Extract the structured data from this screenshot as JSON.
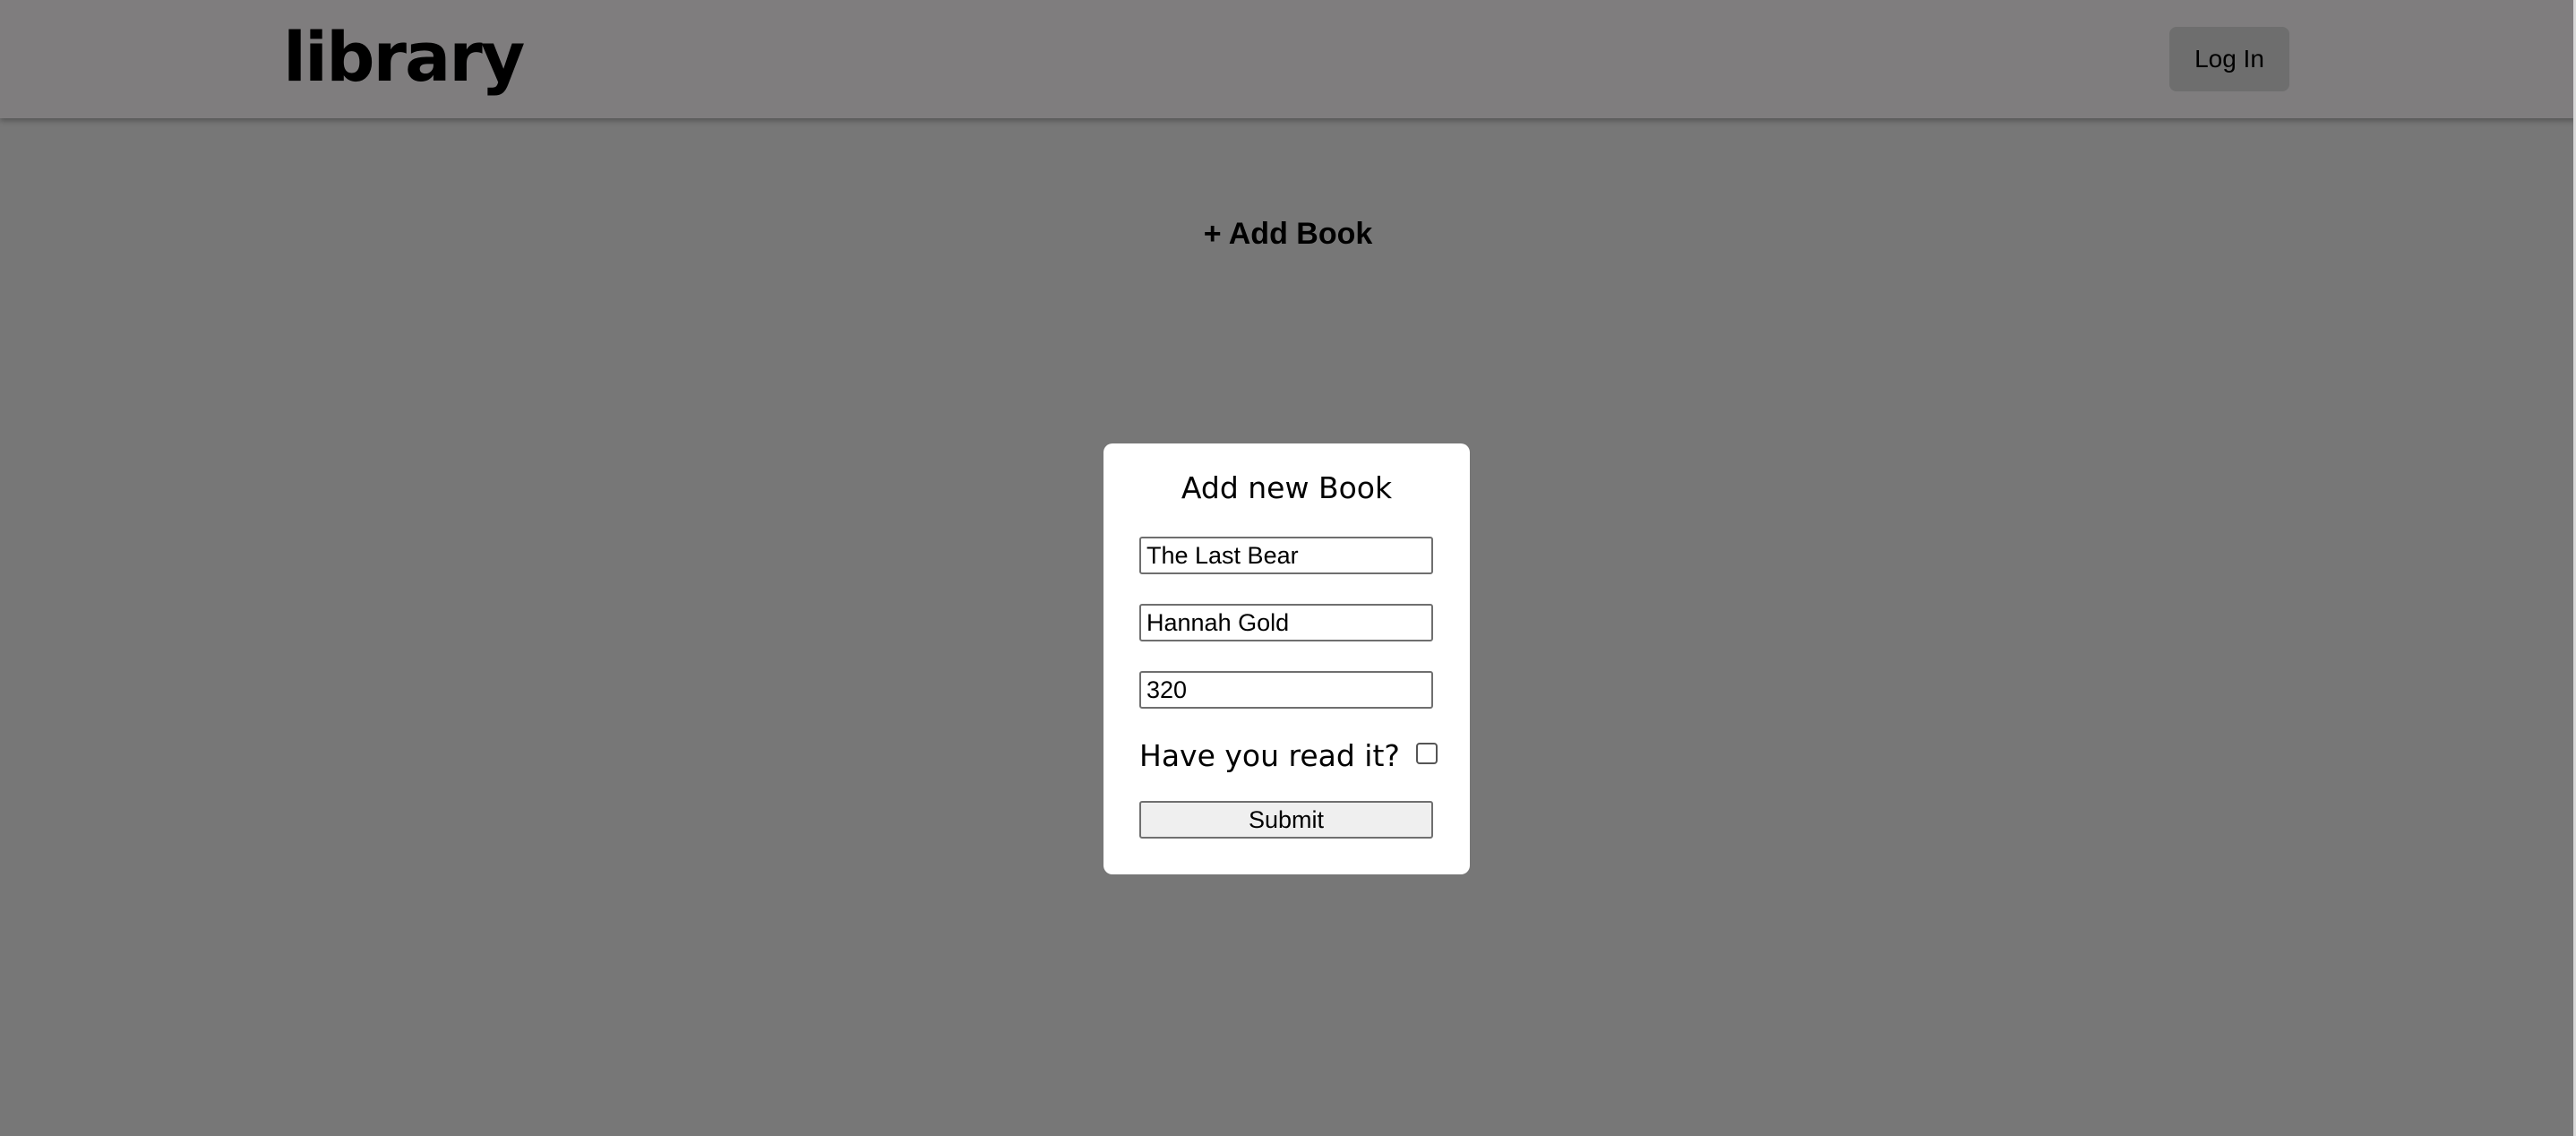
{
  "header": {
    "logo": "library",
    "login_label": "Log In"
  },
  "main": {
    "add_book_label": "+ Add Book"
  },
  "modal": {
    "title": "Add new Book",
    "title_field": {
      "value": "The Last Bear"
    },
    "author_field": {
      "value": "Hannah Gold"
    },
    "pages_field": {
      "value": "320"
    },
    "read_label": "Have you read it?",
    "read_checked": false,
    "submit_label": "Submit"
  }
}
